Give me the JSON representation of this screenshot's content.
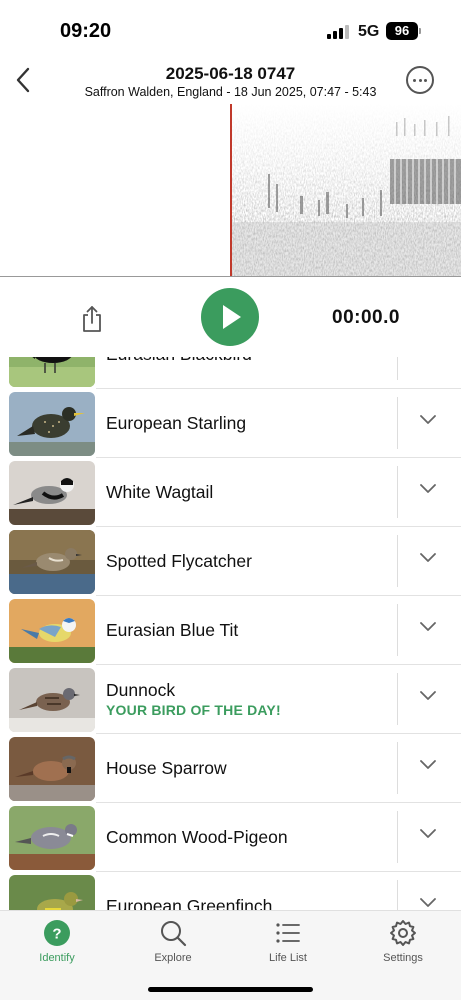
{
  "status": {
    "time": "09:20",
    "network": "5G",
    "battery": "96"
  },
  "header": {
    "title": "2025-06-18 0747",
    "subtitle": "Saffron Walden, England - 18 Jun 2025, 07:47 - 5:43"
  },
  "player": {
    "timer": "00:00.0"
  },
  "species": [
    {
      "name": "Eurasian Blackbird",
      "icon": "chevron-down-icon"
    },
    {
      "name": "European Starling",
      "icon": "chevron-down-icon"
    },
    {
      "name": "White Wagtail",
      "icon": "chevron-down-icon"
    },
    {
      "name": "Spotted Flycatcher",
      "icon": "chevron-down-icon"
    },
    {
      "name": "Eurasian Blue Tit",
      "icon": "chevron-down-icon"
    },
    {
      "name": "Dunnock",
      "tag": "YOUR BIRD OF THE DAY!",
      "icon": "chevron-down-icon"
    },
    {
      "name": "House Sparrow",
      "icon": "chevron-down-icon"
    },
    {
      "name": "Common Wood-Pigeon",
      "icon": "chevron-down-icon"
    },
    {
      "name": "European Greenfinch",
      "icon": "chevron-down-icon"
    }
  ],
  "tabs": [
    {
      "label": "Identify",
      "icon": "question-circle-icon",
      "active": true
    },
    {
      "label": "Explore",
      "icon": "search-icon"
    },
    {
      "label": "Life List",
      "icon": "list-icon"
    },
    {
      "label": "Settings",
      "icon": "gear-icon"
    }
  ],
  "colors": {
    "accent": "#3b9c5e",
    "playhead": "#c0392b"
  }
}
